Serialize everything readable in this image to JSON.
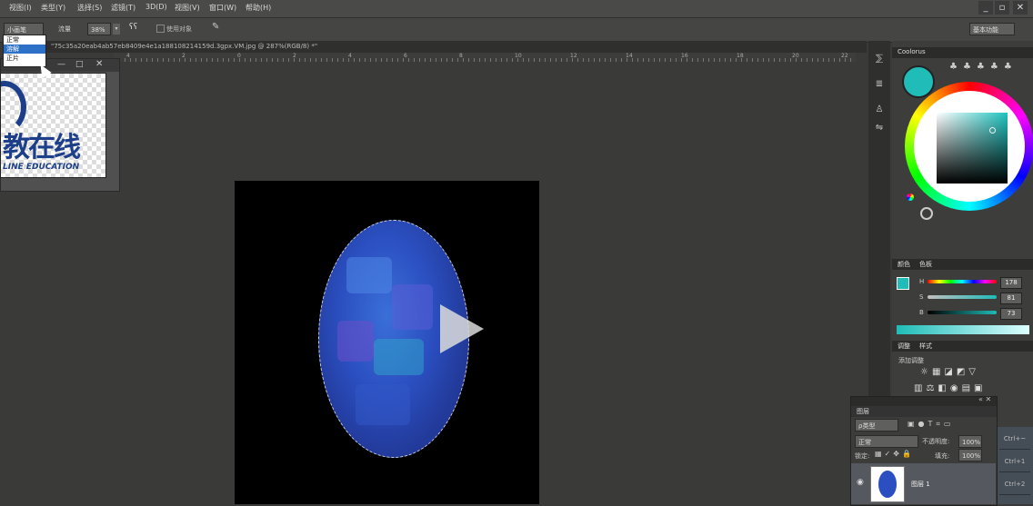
{
  "menu": {
    "items": [
      "视图(I)",
      "类型(Y)",
      "选择(S)",
      "滤镜(T)",
      "3D(D)",
      "视图(V)",
      "窗口(W)",
      "帮助(H)"
    ]
  },
  "window_controls": [
    "_",
    "▫",
    "✕"
  ],
  "options": {
    "mode_value": "小画笔",
    "zoom_label": "流量",
    "zoom_value": "38%",
    "checkbox_label": "使用对象",
    "workspace_value": "基本功能"
  },
  "dropdown": {
    "options": [
      "正常",
      "溶解",
      "正片"
    ],
    "selected_index": 1
  },
  "document": {
    "tab_title": "\"75c35a20eab4ab57eb8409e4e1a188108214159d.3gpx.VM.jpg @ 287%(RGB/8) *\"",
    "ruler_ticks": [
      "4",
      "2",
      "0",
      "2",
      "4",
      "6",
      "8",
      "10",
      "12",
      "14",
      "16",
      "18",
      "20",
      "22"
    ]
  },
  "navigator": {
    "brand_cn": "教在线",
    "brand_en": "LINE EDUCATION"
  },
  "color_panel": {
    "title": "Coolorus",
    "tabs": [
      "颜色",
      "色板"
    ],
    "h_label": "H",
    "h_value": "178",
    "s_label": "S",
    "s_value": "81",
    "b_label": "B",
    "b_value": "73",
    "accent": "#1fbcb8"
  },
  "adjust_panel": {
    "tabs": [
      "调整",
      "样式"
    ],
    "title": "添加调整"
  },
  "layers_panel": {
    "tabs": [
      "图层"
    ],
    "filter_label": "ρ类型",
    "blend_mode": "正常",
    "opacity_label": "不透明度:",
    "opacity_value": "100%",
    "lock_label": "锁定:",
    "fill_label": "填充:",
    "fill_value": "100%",
    "layer_name": "图层 1"
  },
  "side_buttons": [
    "Ctrl+~",
    "Ctrl+1",
    "Ctrl+2"
  ]
}
